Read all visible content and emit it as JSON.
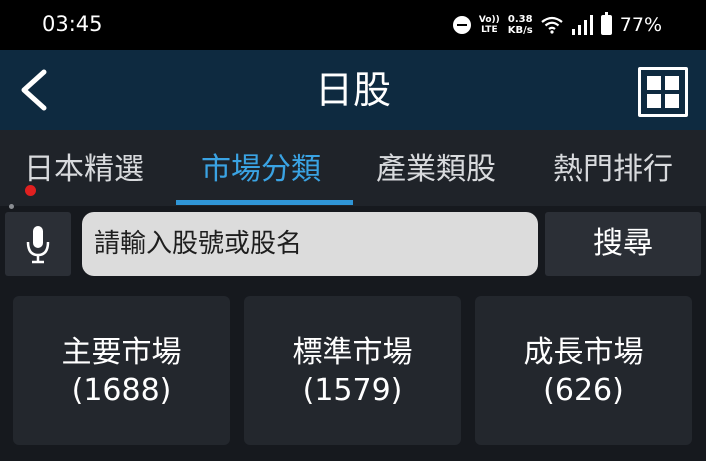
{
  "status_bar": {
    "time": "03:45",
    "volte_top": "Vo))",
    "volte_bottom": "LTE",
    "speed_value": "0.38",
    "speed_unit": "KB/s",
    "battery_percent": "77%"
  },
  "header": {
    "title": "日股",
    "back_icon": "chevron-left-icon",
    "menu_icon": "grid-icon"
  },
  "tabs": [
    {
      "label": "日本精選",
      "active": false
    },
    {
      "label": "市場分類",
      "active": true
    },
    {
      "label": "產業類股",
      "active": false
    },
    {
      "label": "熱門排行",
      "active": false
    }
  ],
  "search": {
    "placeholder": "請輸入股號或股名",
    "button_label": "搜尋",
    "mic_icon": "microphone-icon"
  },
  "markets": [
    {
      "name": "主要市場",
      "count": "(1688)"
    },
    {
      "name": "標準市場",
      "count": "(1579)"
    },
    {
      "name": "成長市場",
      "count": "(626)"
    }
  ],
  "colors": {
    "header_bg": "#0e2a40",
    "active_tab": "#3aa3e3",
    "card_bg": "#23272d",
    "page_bg": "#16191e"
  }
}
